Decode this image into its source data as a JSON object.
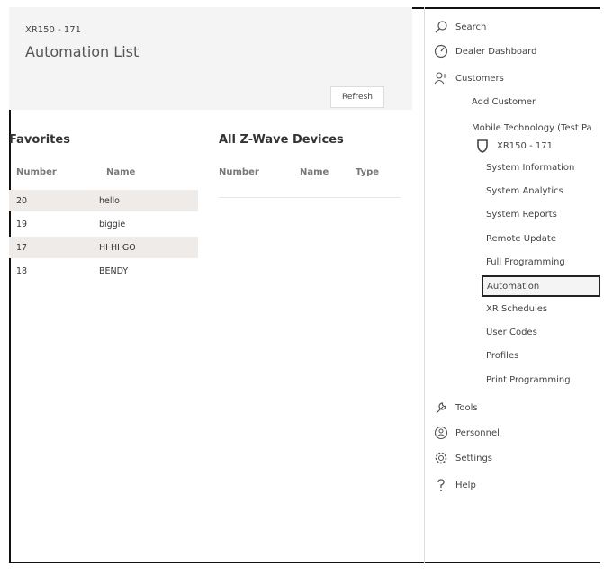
{
  "header": {
    "breadcrumb": "XR150 - 171",
    "title": "Automation List",
    "refresh_label": "Refresh"
  },
  "favorites": {
    "title": "Favorites",
    "columns": [
      "Number",
      "Name"
    ],
    "rows": [
      {
        "number": "20",
        "name": "hello"
      },
      {
        "number": "19",
        "name": "biggie"
      },
      {
        "number": "17",
        "name": "HI HI GO"
      },
      {
        "number": "18",
        "name": "BENDY"
      }
    ]
  },
  "zwave": {
    "title": "All Z-Wave Devices",
    "columns": [
      "Number",
      "Name",
      "Type"
    ]
  },
  "sidebar": {
    "search": "Search",
    "dealer_dashboard": "Dealer Dashboard",
    "customers": "Customers",
    "add_customer": "Add Customer",
    "customer_name": "Mobile Technology (Test Pa",
    "panel": "XR150 - 171",
    "panel_items": [
      "System Information",
      "System Analytics",
      "System Reports",
      "Remote Update",
      "Full Programming",
      "Automation",
      "XR Schedules",
      "User Codes",
      "Profiles",
      "Print Programming"
    ],
    "tools": "Tools",
    "personnel": "Personnel",
    "settings": "Settings",
    "help": "Help"
  }
}
